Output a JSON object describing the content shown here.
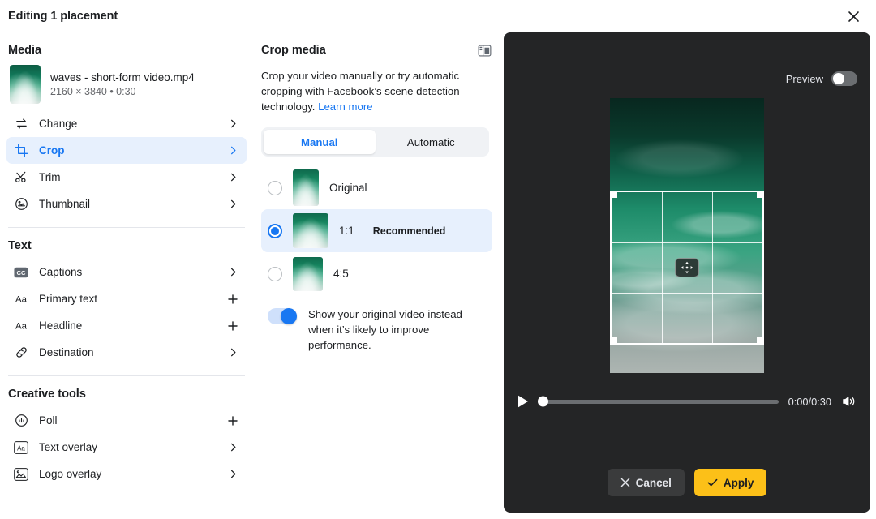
{
  "header": {
    "title": "Editing 1 placement",
    "close_icon": "close-icon"
  },
  "sidebar": {
    "media_section": {
      "title": "Media",
      "file_name": "waves - short-form video.mp4",
      "file_meta": "2160 × 3840 • 0:30"
    },
    "media_items": [
      {
        "label": "Change",
        "icon": "swap-arrows-icon",
        "action": "chevron-right-icon",
        "active": false
      },
      {
        "label": "Crop",
        "icon": "crop-icon",
        "action": "chevron-right-icon",
        "active": true
      },
      {
        "label": "Trim",
        "icon": "scissors-icon",
        "action": "chevron-right-icon",
        "active": false
      },
      {
        "label": "Thumbnail",
        "icon": "image-circle-icon",
        "action": "chevron-right-icon",
        "active": false
      }
    ],
    "text_section": {
      "title": "Text"
    },
    "text_items": [
      {
        "label": "Captions",
        "icon": "cc-icon",
        "action": "chevron-right-icon"
      },
      {
        "label": "Primary text",
        "icon": "aa-text-icon",
        "action": "plus-icon"
      },
      {
        "label": "Headline",
        "icon": "aa-text-icon",
        "action": "plus-icon"
      },
      {
        "label": "Destination",
        "icon": "link-icon",
        "action": "chevron-right-icon"
      }
    ],
    "creative_section": {
      "title": "Creative tools"
    },
    "creative_items": [
      {
        "label": "Poll",
        "icon": "poll-icon",
        "action": "plus-icon"
      },
      {
        "label": "Text overlay",
        "icon": "text-overlay-icon",
        "action": "chevron-right-icon"
      },
      {
        "label": "Logo overlay",
        "icon": "logo-overlay-icon",
        "action": "chevron-right-icon"
      }
    ]
  },
  "center": {
    "title": "Crop media",
    "panel_toggle_icon": "panel-layout-icon",
    "description_part1": "Crop your video manually or try automatic cropping with Facebook’s scene detection technology. ",
    "learn_more": "Learn more",
    "tabs": [
      {
        "label": "Manual",
        "active": true
      },
      {
        "label": "Automatic",
        "active": false
      }
    ],
    "ratios": [
      {
        "label": "Original",
        "badge": "",
        "selected": false
      },
      {
        "label": "1:1",
        "badge": "Recommended",
        "selected": true
      },
      {
        "label": "4:5",
        "badge": "",
        "selected": false
      }
    ],
    "toggle": {
      "text": "Show your original video instead when it’s likely to improve performance.",
      "on": true
    }
  },
  "preview": {
    "label": "Preview",
    "toggle_on": false,
    "move_handle_icon": "move-icon",
    "player": {
      "play_icon": "play-icon",
      "progress_percent": 0,
      "time": "0:00/0:30",
      "volume_icon": "volume-icon"
    },
    "buttons": {
      "cancel": {
        "label": "Cancel",
        "icon": "x-icon"
      },
      "apply": {
        "label": "Apply",
        "icon": "check-icon"
      }
    }
  },
  "colors": {
    "accent_blue": "#1877f2",
    "apply_yellow": "#fcc018",
    "panel_dark": "#242526",
    "selected_row": "#e7f0fd"
  }
}
